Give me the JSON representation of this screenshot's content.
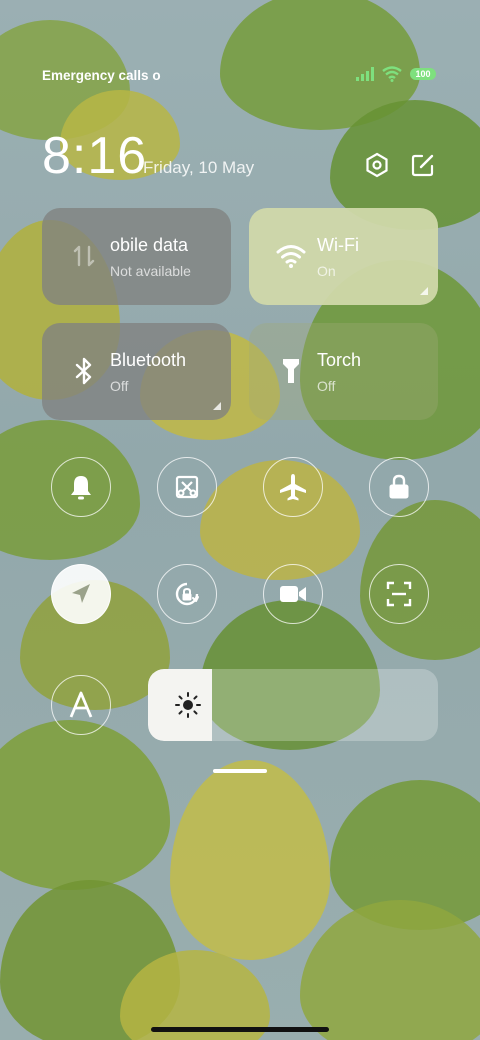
{
  "status_bar": {
    "carrier": "Emergency calls o",
    "battery": "100",
    "icons": [
      "signal-icon",
      "wifi-icon",
      "battery-icon"
    ]
  },
  "header": {
    "time": "8:16",
    "date": "Friday, 10 May",
    "settings_icon": "settings-icon",
    "edit_icon": "edit-icon"
  },
  "tiles": {
    "mobile_data": {
      "title": "obile data",
      "subtitle": "Not available",
      "icon": "mobile-data-icon"
    },
    "wifi": {
      "title": "Wi-Fi",
      "subtitle": "On",
      "icon": "wifi-icon",
      "active": true
    },
    "bluetooth": {
      "title": "Bluetooth",
      "subtitle": "Off",
      "icon": "bluetooth-icon"
    },
    "torch": {
      "title": "Torch",
      "subtitle": "Off",
      "icon": "torch-icon"
    }
  },
  "toggles": [
    {
      "icon": "bell-icon",
      "active": false
    },
    {
      "icon": "screenshot-icon",
      "active": false
    },
    {
      "icon": "airplane-icon",
      "active": false
    },
    {
      "icon": "lock-icon",
      "active": false
    },
    {
      "icon": "location-icon",
      "active": true
    },
    {
      "icon": "rotation-lock-icon",
      "active": false
    },
    {
      "icon": "video-camera-icon",
      "active": false
    },
    {
      "icon": "scanner-icon",
      "active": false
    },
    {
      "icon": "font-icon",
      "active": false
    }
  ],
  "brightness": {
    "level_percent": 22,
    "icon": "brightness-icon"
  },
  "colors": {
    "wifi_tile": "#c9d3a5",
    "inactive_tile": "#8e938f",
    "accent": "#ffffff"
  }
}
